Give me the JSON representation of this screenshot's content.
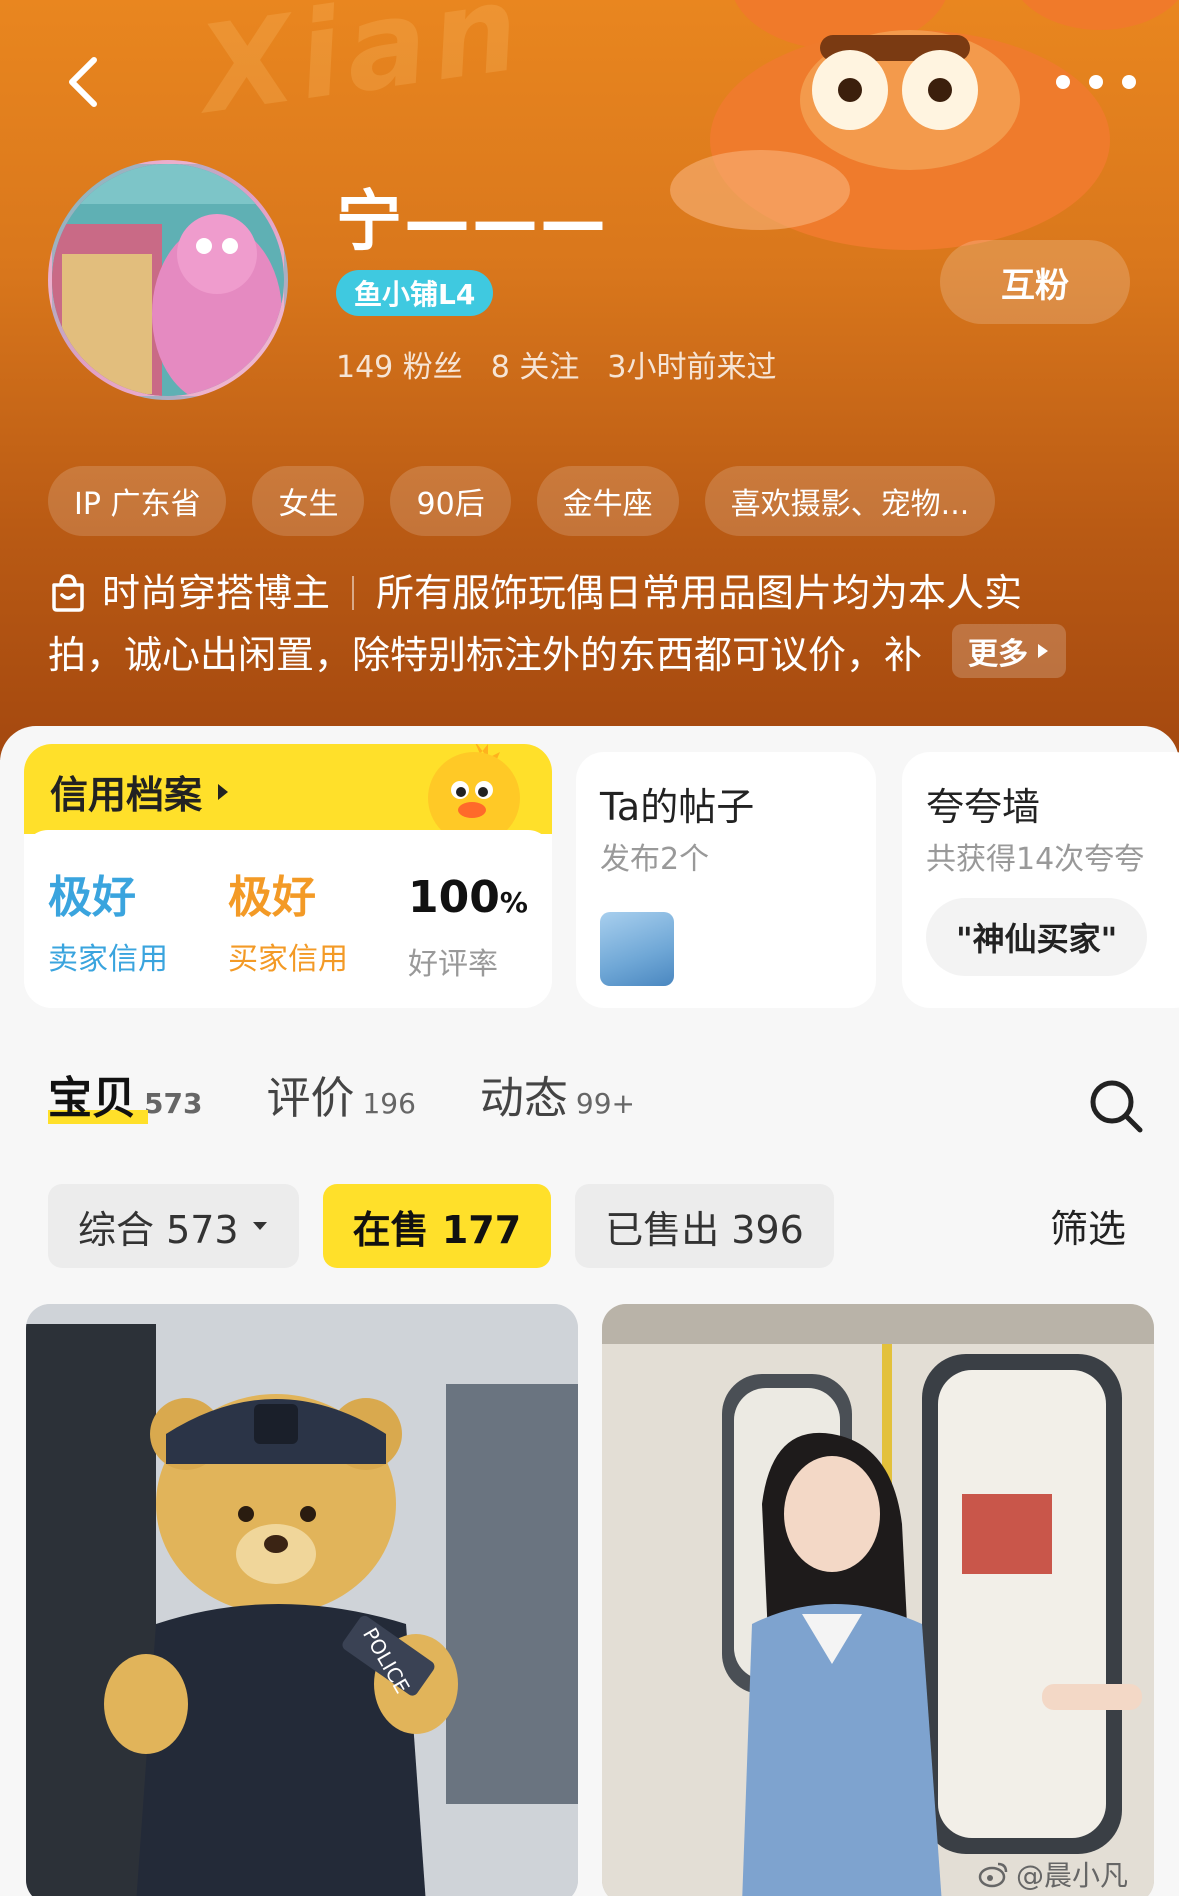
{
  "header": {
    "username": "宁———",
    "level_badge": "鱼小铺L4",
    "follow_button": "互粉",
    "stats": {
      "fans": "149 粉丝",
      "following": "8 关注",
      "last_visit": "3小时前来过"
    },
    "tags": [
      "IP 广东省",
      "女生",
      "90后",
      "金牛座",
      "喜欢摄影、宠物..."
    ],
    "bio_line1_a": "时尚穿搭博主",
    "bio_line1_b": "所有服饰玩偶日常用品图片均为本人实",
    "bio_line2": "拍，诚心出闲置，除特别标注外的东西都可议价，补",
    "bio_more": "更多"
  },
  "credit": {
    "title": "信用档案",
    "seller_value": "极好",
    "seller_label": "卖家信用",
    "buyer_value": "极好",
    "buyer_label": "买家信用",
    "rate_value": "100",
    "rate_unit": "%",
    "rate_label": "好评率"
  },
  "posts": {
    "title": "Ta的帖子",
    "sub": "发布2个"
  },
  "wall": {
    "title": "夸夸墙",
    "sub": "共获得14次夸夸",
    "chip": "\"神仙买家\""
  },
  "tabs": [
    {
      "label": "宝贝",
      "count": "573"
    },
    {
      "label": "评价",
      "count": "196"
    },
    {
      "label": "动态",
      "count": "99+"
    }
  ],
  "filters": [
    {
      "label": "综合 573"
    },
    {
      "label": "在售 177"
    },
    {
      "label": "已售出 396"
    }
  ],
  "filter_button": "筛选",
  "watermark": "@晨小凡",
  "colors": {
    "accent_yellow": "#ffe02a",
    "header_orange": "#e9861f",
    "credit_blue": "#3aa4de",
    "credit_orange": "#f39a26",
    "level_badge": "#3fc9e0"
  }
}
